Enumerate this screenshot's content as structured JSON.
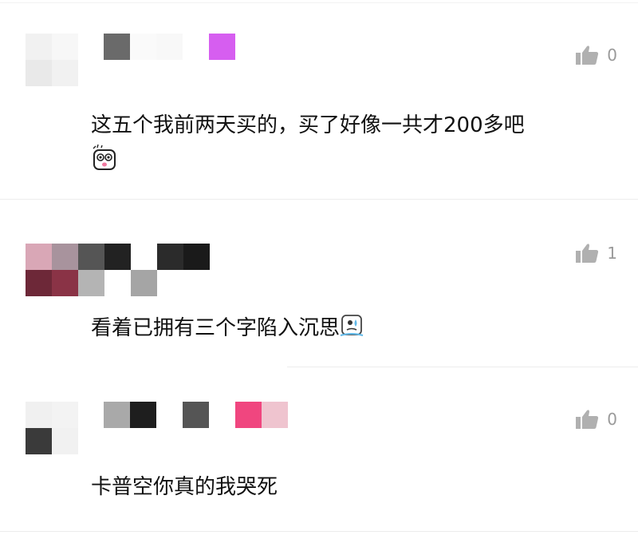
{
  "comments": [
    {
      "text": "这五个我前两天买的，买了好像一共才200多吧",
      "emoji": "surprised-face-emoji",
      "like_count": "0"
    },
    {
      "text": "看着已拥有三个字陷入沉思",
      "emoji": "sweating-face-emoji",
      "like_count": "1"
    },
    {
      "text": "卡普空你真的我哭死",
      "like_count": "0"
    }
  ],
  "icons": {
    "like": "thumbs-up-icon"
  },
  "colors": {
    "like_icon": "#b0b0b0",
    "text": "#111111",
    "divider": "#ececec"
  }
}
